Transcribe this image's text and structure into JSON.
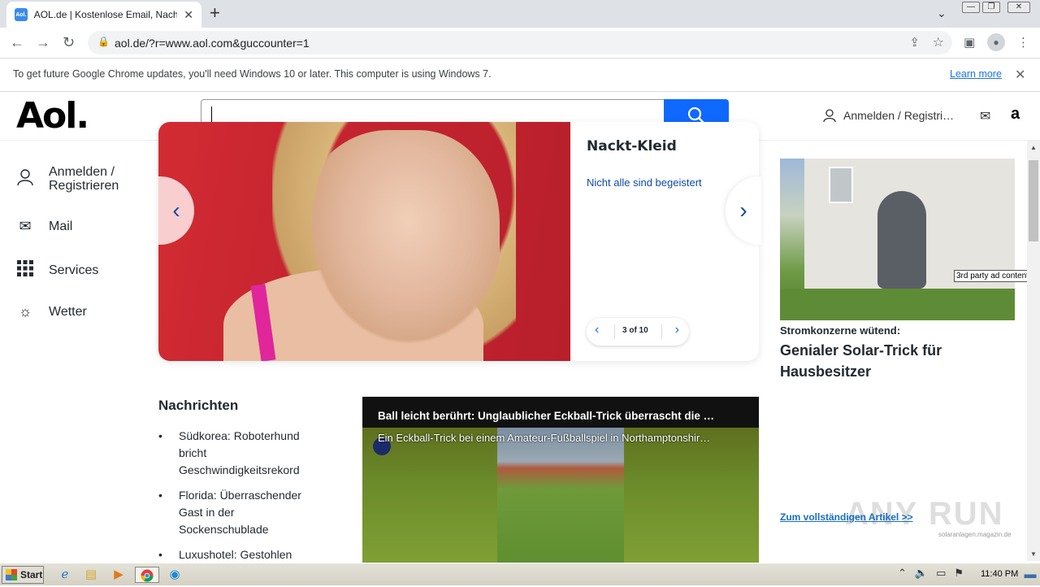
{
  "browser": {
    "tab_title": "AOL.de | Kostenlose Email, Nachrichten",
    "tab_favicon": "Aol.",
    "url": "aol.de/?r=www.aol.com&guccounter=1",
    "infobar_message": "To get future Google Chrome updates, you'll need Windows 10 or later. This computer is using Windows 7.",
    "infobar_link": "Learn more"
  },
  "header": {
    "logo": "Aol.",
    "search_value": "",
    "signin": "Anmelden / Registri…",
    "amazon": "a"
  },
  "sidebar": {
    "items": [
      {
        "label": "Anmelden /\nRegistrieren",
        "icon": "user-icon"
      },
      {
        "label": "Mail",
        "icon": "mail-icon"
      },
      {
        "label": "Services",
        "icon": "grid-icon"
      },
      {
        "label": "Wetter",
        "icon": "weather-icon"
      }
    ]
  },
  "carousel": {
    "headline": "Nackt-Kleid",
    "subline": "Nicht alle sind begeistert",
    "counter": "3 of 10"
  },
  "ad": {
    "label": "3rd party ad content",
    "kicker": "Stromkonzerne wütend:",
    "title": "Genialer Solar-Trick für Hausbesitzer",
    "more": "Zum vollständigen Artikel >>",
    "source": "solaranlagen.magazin.de"
  },
  "news": {
    "heading": "Nachrichten",
    "items": [
      "Südkorea: Roboterhund bricht Geschwindigkeitsrekord",
      "Florida: Überraschender Gast in der Sockenschublade",
      "Luxushotel: Gestohlen"
    ]
  },
  "video": {
    "title": "Ball leicht berührt: Unglaublicher Eckball-Trick überrascht die …",
    "subtitle": "Ein Eckball-Trick bei einem Amateur-Fußballspiel in Northamptonshir…"
  },
  "taskbar": {
    "start": "Start",
    "clock": "11:40 PM"
  },
  "watermark": "ANY RUN",
  "colors": {
    "accent": "#0f69ff",
    "link": "#0f4aa8"
  }
}
